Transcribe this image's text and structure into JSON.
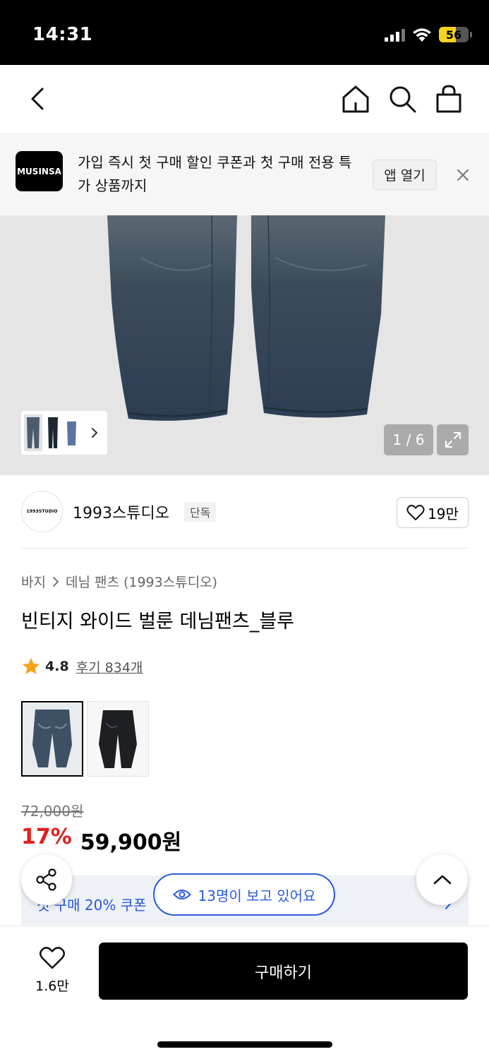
{
  "status_bar": {
    "time": "14:31",
    "battery": "56",
    "battery_level": 0.56
  },
  "app_banner": {
    "logo": "MUSINSA",
    "text": "가입 즉시 첫 구매 할인 쿠폰과 첫 구매 전용 특가 상품까지",
    "open_label": "앱 열기"
  },
  "gallery": {
    "page": "1 / 6"
  },
  "brand": {
    "logo_text": "1993STUDIO",
    "name": "1993스튜디오",
    "tag": "단독",
    "likes": "19만"
  },
  "breadcrumb": {
    "category": "바지",
    "subcategory": "데님 팬츠 (1993스튜디오)"
  },
  "product": {
    "title": "빈티지 와이드 벌룬 데님팬츠_블루",
    "rating": "4.8",
    "reviews": "후기 834개",
    "original_price": "72,000원",
    "discount": "17%",
    "sale_price": "59,900원"
  },
  "coupon": {
    "text": "첫 구매 20% 쿠폰"
  },
  "viewers": {
    "text": "13명이 보고 있어요"
  },
  "bottom_bar": {
    "likes": "1.6만",
    "buy_label": "구매하기"
  },
  "colors": {
    "accent_blue": "#2b5be0",
    "sale_red": "#e0201d",
    "battery_yellow": "#f5d21f"
  }
}
